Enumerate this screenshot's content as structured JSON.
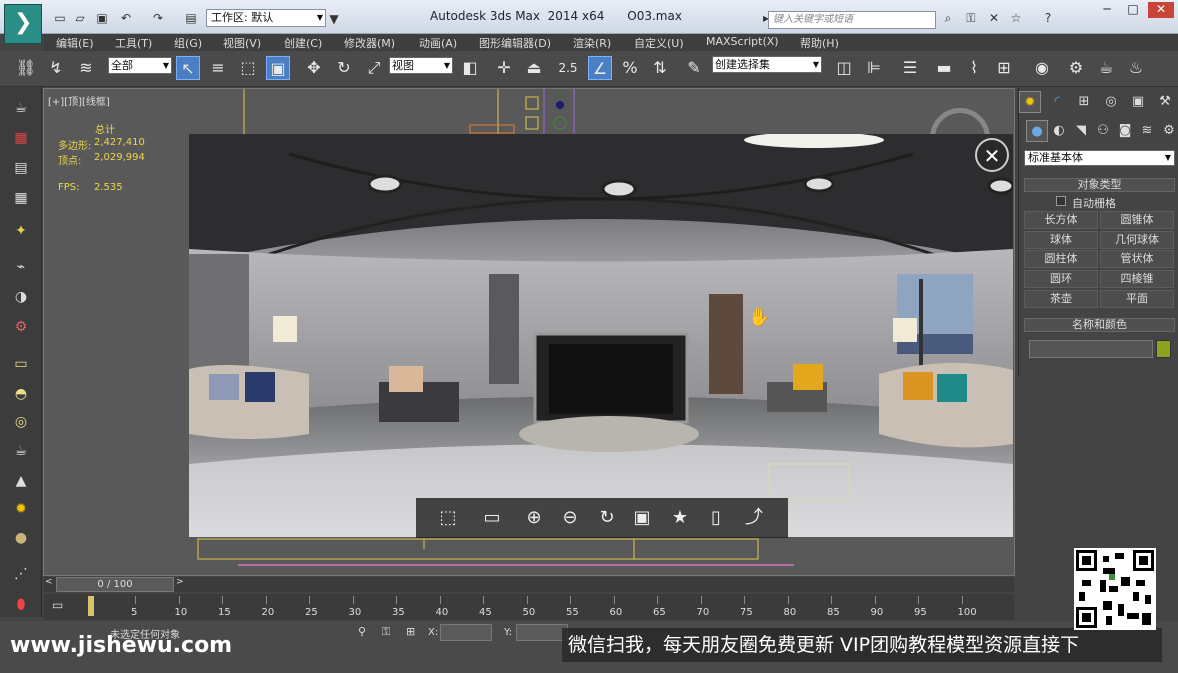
{
  "title_bar": {
    "workspace_label": "工作区: 默认",
    "title": "Autodesk 3ds Max  2014 x64      O03.max",
    "search_placeholder": "键入关键字或短语"
  },
  "menu": [
    "编辑(E)",
    "工具(T)",
    "组(G)",
    "视图(V)",
    "创建(C)",
    "修改器(M)",
    "动画(A)",
    "图形编辑器(D)",
    "渲染(R)",
    "自定义(U)",
    "MAXScript(X)",
    "帮助(H)"
  ],
  "toolbar": {
    "selection_filter": "全部",
    "ref_coord": "视图",
    "snap_value": "2.5",
    "named_selection": "创建选择集"
  },
  "viewport": {
    "label": "[+][顶][线框]",
    "stats_title": "总计",
    "poly_label": "多边形:",
    "poly_value": "2,427,410",
    "vert_label": "顶点:",
    "vert_value": "2,029,994",
    "fps_label": "FPS:",
    "fps_value": "2.535"
  },
  "command_panel": {
    "primitive_type": "标准基本体",
    "object_type_title": "对象类型",
    "autogrid_label": "自动栅格",
    "buttons": [
      "长方体",
      "圆锥体",
      "球体",
      "几何球体",
      "圆柱体",
      "管状体",
      "圆环",
      "四棱锥",
      "茶壶",
      "平面"
    ],
    "name_color_title": "名称和颜色",
    "swatch_color": "#8da21f"
  },
  "timeline": {
    "frame_display": "0 / 100",
    "ticks": [
      "5",
      "10",
      "15",
      "20",
      "25",
      "30",
      "35",
      "40",
      "45",
      "50",
      "55",
      "60",
      "65",
      "70",
      "75",
      "80",
      "85",
      "90",
      "95",
      "100"
    ]
  },
  "status": {
    "selection_text": "未选定任何对象",
    "x_label": "X:",
    "y_label": "Y:"
  },
  "watermark": {
    "site": "www.jishewu.com",
    "banner": "微信扫我，每天朋友圈免费更新 VIP团购教程模型资源直接下"
  }
}
